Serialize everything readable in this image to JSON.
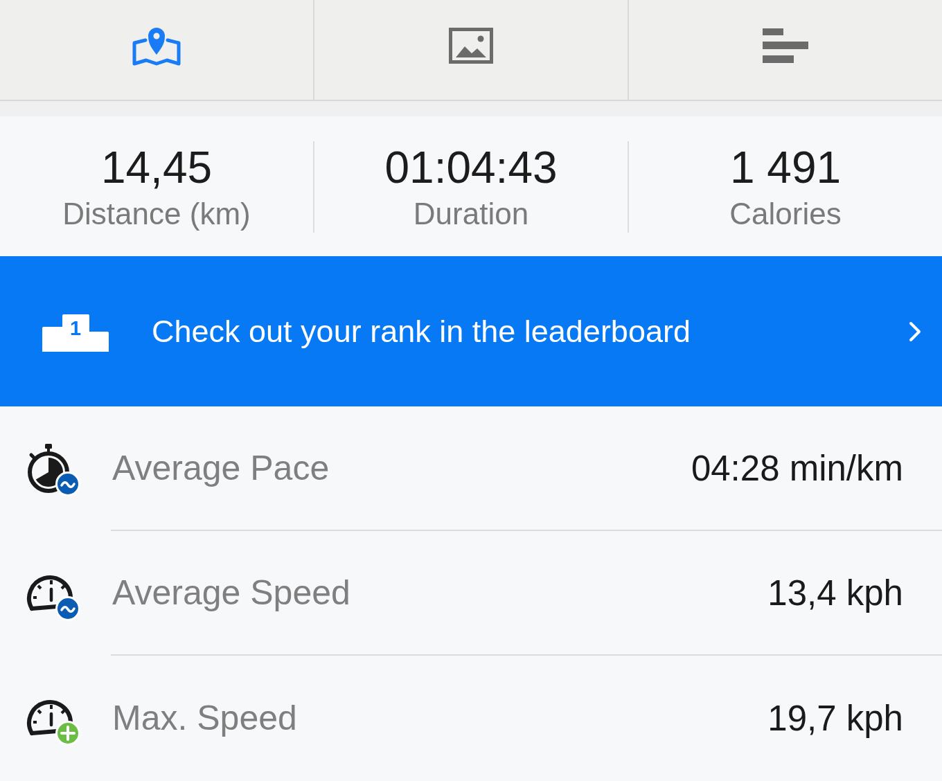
{
  "tabs": [
    {
      "kind": "map",
      "selected": true
    },
    {
      "kind": "photos",
      "selected": false
    },
    {
      "kind": "chart",
      "selected": false
    }
  ],
  "summary": [
    {
      "value": "14,45",
      "label": "Distance (km)"
    },
    {
      "value": "01:04:43",
      "label": "Duration"
    },
    {
      "value": "1 491",
      "label": "Calories"
    }
  ],
  "leaderboard_banner": {
    "podium_number": "1",
    "text": "Check out your rank in the leaderboard"
  },
  "metrics": [
    {
      "kind": "avgpace",
      "label": "Average Pace",
      "value": "04:28 min/km"
    },
    {
      "kind": "avgspeed",
      "label": "Average Speed",
      "value": "13,4 kph"
    },
    {
      "kind": "maxspeed",
      "label": "Max. Speed",
      "value": "19,7 kph"
    }
  ]
}
